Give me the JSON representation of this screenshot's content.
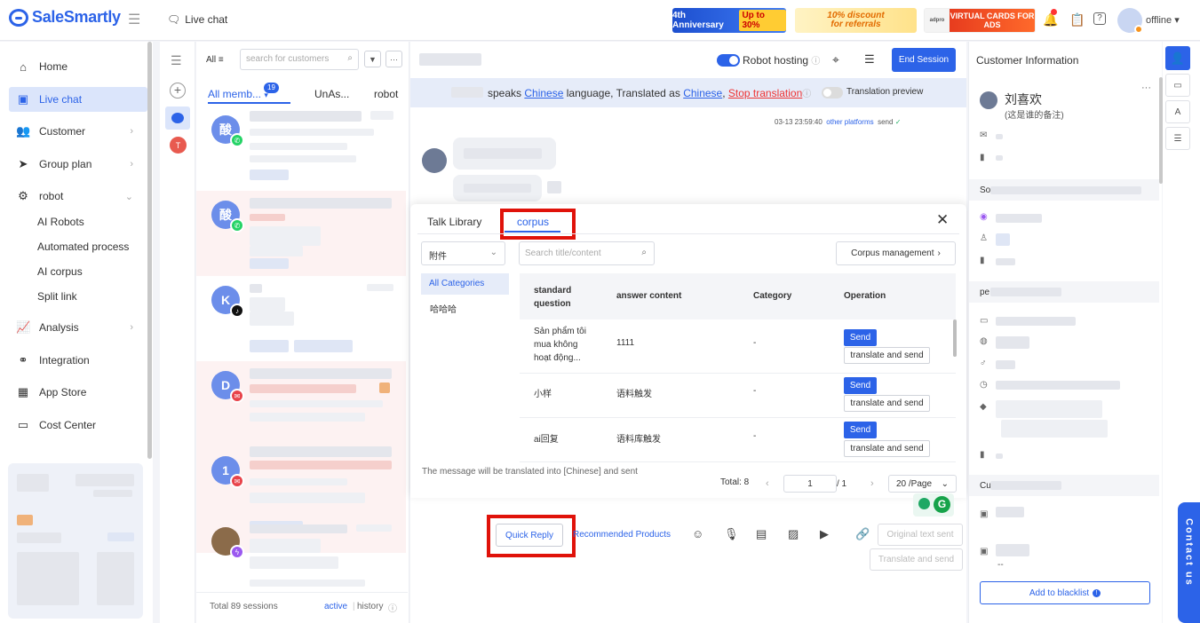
{
  "app": {
    "brand": "SaleSmartly",
    "current_tab": "Live chat",
    "user_status": "offline"
  },
  "banners": {
    "anniversary": "4th Anniversary",
    "anniversary_tag": "Up to 30%",
    "discount_line1": "10% discount",
    "discount_line2": "for referrals",
    "ads_left": "adpro",
    "ads_right": "VIRTUAL CARDS FOR ADS"
  },
  "nav": {
    "home": "Home",
    "live_chat": "Live chat",
    "customer": "Customer",
    "group_plan": "Group plan",
    "robot": "robot",
    "ai_robots": "AI Robots",
    "automated_process": "Automated process",
    "ai_corpus": "AI corpus",
    "split_link": "Split link",
    "analysis": "Analysis",
    "integration": "Integration",
    "app_store": "App Store",
    "cost_center": "Cost Center"
  },
  "sessions": {
    "filter_all": "All",
    "search_placeholder": "search for customers",
    "tabs": {
      "all": "All memb...",
      "all_badge": "19",
      "unassigned": "UnAs...",
      "robot": "robot"
    },
    "items": [
      {
        "initial": "酸",
        "channel": "whatsapp"
      },
      {
        "initial": "酸",
        "channel": "whatsapp"
      },
      {
        "initial": "K",
        "channel": "tiktok"
      },
      {
        "initial": "D",
        "channel": "email"
      },
      {
        "initial": "1",
        "channel": "email"
      },
      {
        "initial": "",
        "channel": "messenger"
      }
    ],
    "total_label": "Total 89 sessions",
    "active_label": "active",
    "history_label": "history",
    "strip_badge": "T"
  },
  "chat": {
    "robot_hosting": "Robot hosting",
    "end_session": "End Session",
    "translation": {
      "t1": "speaks",
      "lang1": "Chinese",
      "t2": "language, Translated as",
      "lang2": "Chinese",
      "stop": "Stop translation",
      "preview": "Translation preview"
    },
    "message_time": "03-13 23:59:40",
    "message_platform": "other platforms",
    "message_status": "send",
    "composer_note": "The message will be translated into [Chinese] and sent",
    "quick_reply": "Quick Reply",
    "recommended_products": "Recommended Products",
    "original_sent": "Original text sent",
    "translate_sent": "Translate and send"
  },
  "popup": {
    "tab_talk": "Talk Library",
    "tab_corpus": "corpus",
    "attachment_select": "附件",
    "search_placeholder": "Search title/content",
    "corpus_management": "Corpus management",
    "categories": [
      "All Categories",
      "哈哈哈"
    ],
    "columns": [
      "standard question",
      "answer content",
      "Category",
      "Operation"
    ],
    "rows": [
      {
        "question": "Sản phẩm tôi mua không hoạt động...",
        "answer": "1111",
        "category": "-"
      },
      {
        "question": "小样",
        "answer": "语料触发",
        "category": "-"
      },
      {
        "question": "ai回复",
        "answer": "语料库触发",
        "category": "-"
      }
    ],
    "send_label": "Send",
    "translate_send_label": "translate and send",
    "pagination": {
      "total": "Total:  8",
      "page": "1",
      "pages": "/  1",
      "per_page": "20 /Page"
    }
  },
  "customer": {
    "title": "Customer Information",
    "name": "刘喜欢",
    "remark": "(这是谁的备注)",
    "section_so": "So",
    "section_pe": "pe",
    "section_cu": "Cu",
    "dash": "--",
    "blacklist": "Add to blacklist"
  },
  "contact_us": "Contact us",
  "colors": {
    "accent": "#2c63e8",
    "highlight_box": "#e0120a"
  }
}
